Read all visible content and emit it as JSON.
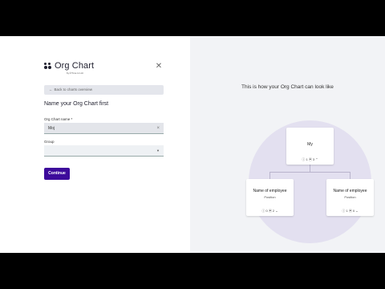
{
  "brand": {
    "name": "Org Chart",
    "sub": "by ℹ Time is Ltd."
  },
  "back_label": "Back to charts overview",
  "form": {
    "title": "Name your Org Chart first",
    "name_label": "Org Chart name *",
    "name_value": "Moj",
    "group_label": "Group",
    "group_value": "",
    "continue_label": "Continue"
  },
  "preview": {
    "title": "This is how your Org Chart can look like",
    "top_card": {
      "name": "My",
      "meta": "ⓘ 1  ▣ 3  ⌃"
    },
    "left_card": {
      "name": "Name of employee",
      "position": "Position",
      "meta": "ⓘ 0  ▣ 2  ⌄"
    },
    "right_card": {
      "name": "Name of employee",
      "position": "Position",
      "meta": "ⓘ 1  ▣ 0  ⌄"
    }
  },
  "icons": {
    "close": "close-icon",
    "back": "arrow-left-icon",
    "clear": "clear-icon",
    "dropdown": "chevron-down-icon"
  }
}
